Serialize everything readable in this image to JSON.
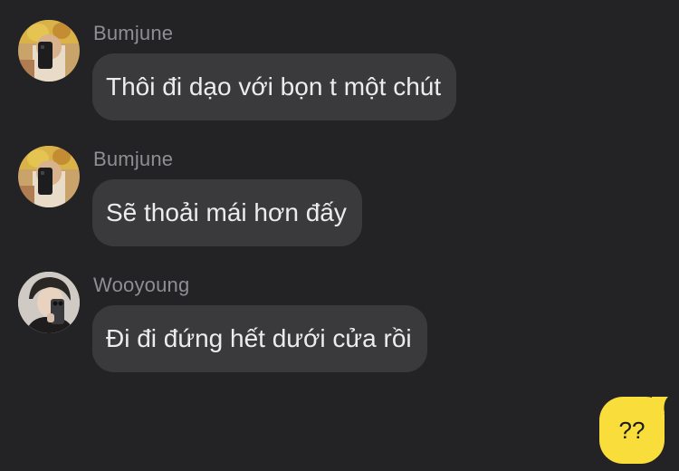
{
  "messages": [
    {
      "sender": "Bumjune",
      "text": "Thôi đi dạo với bọn t một chút"
    },
    {
      "sender": "Bumjune",
      "text": "Sẽ thoải mái hơn đấy"
    },
    {
      "sender": "Wooyoung",
      "text": "Đi đi đứng hết dưới cửa rồi"
    }
  ],
  "my_message": {
    "text": "??"
  },
  "colors": {
    "background": "#232325",
    "bubble_in": "#3a3a3d",
    "bubble_out": "#f8dd3b"
  }
}
